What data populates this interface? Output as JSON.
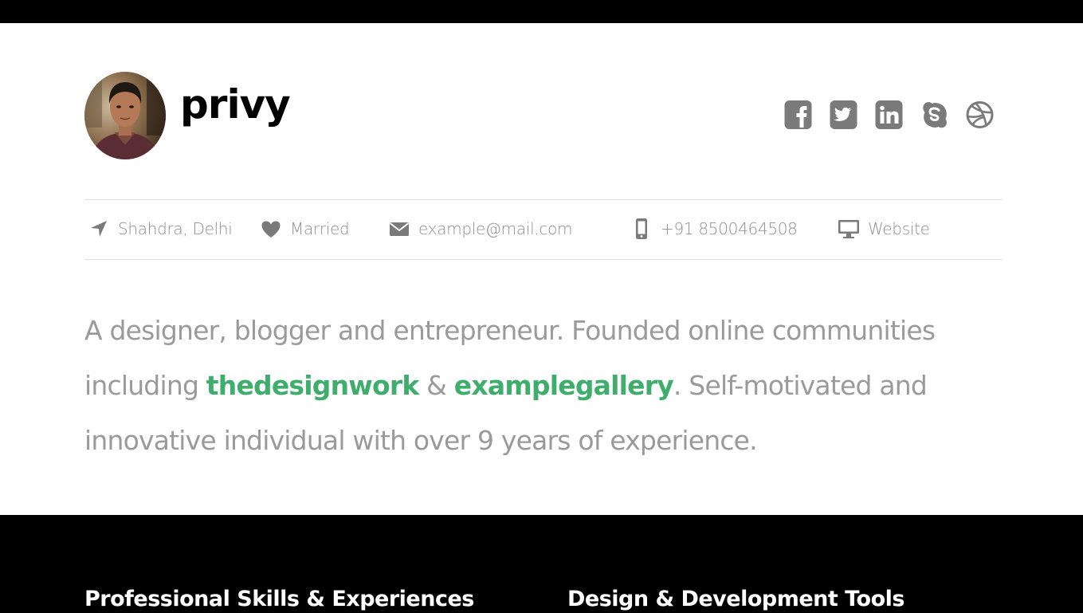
{
  "profile": {
    "name": "privy"
  },
  "social": [
    {
      "icon": "facebook-icon",
      "label": "Facebook"
    },
    {
      "icon": "twitter-icon",
      "label": "Twitter"
    },
    {
      "icon": "linkedin-icon",
      "label": "LinkedIn"
    },
    {
      "icon": "skype-icon",
      "label": "Skype"
    },
    {
      "icon": "dribbble-icon",
      "label": "Dribbble"
    }
  ],
  "info": {
    "location": "Shahdra, Delhi",
    "status": "Married",
    "email": "example@mail.com",
    "phone": "+91 8500464508",
    "website": "Website"
  },
  "bio": {
    "part1": "A designer, blogger and entrepreneur. Founded online communities including ",
    "link1": "thedesignwork",
    "connector": " & ",
    "link2": "examplegallery",
    "part2": ". Self-motivated and innovative individual with over 9 years of experience."
  },
  "sections": {
    "left_title": "Professional Skills & Experiences",
    "right_title": "Design & Development Tools"
  },
  "colors": {
    "accent": "#3fae6c",
    "icon_gray": "#7a7a7a",
    "text_gray": "#8f8f8f",
    "dark_bg": "#000000"
  }
}
